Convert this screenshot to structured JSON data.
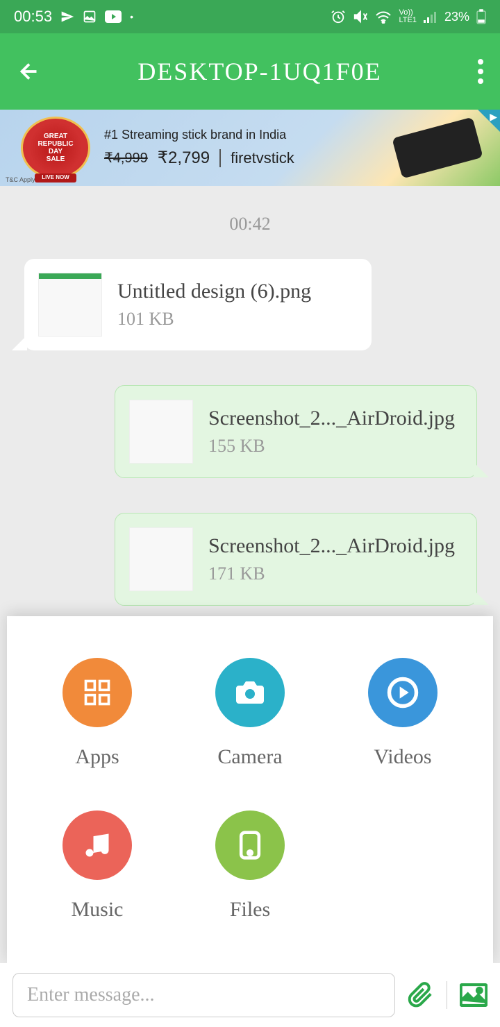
{
  "status": {
    "time": "00:53",
    "battery": "23%"
  },
  "header": {
    "title": "DESKTOP-1UQ1F0E"
  },
  "ad": {
    "headline": "#1 Streaming stick brand in India",
    "old_price": "₹4,999",
    "new_price": "₹2,799",
    "brand": "firetvstick",
    "badge_line1": "GREAT",
    "badge_line2": "REPUBLIC",
    "badge_line3": "DAY",
    "badge_line4": "SALE",
    "ribbon": "LIVE NOW",
    "tc": "T&C Apply"
  },
  "chat": {
    "timestamp": "00:42",
    "messages": [
      {
        "direction": "incoming",
        "filename": "Untitled design (6).png",
        "size": "101 KB"
      },
      {
        "direction": "outgoing",
        "filename": "Screenshot_2..._AirDroid.jpg",
        "size": "155 KB"
      },
      {
        "direction": "outgoing",
        "filename": "Screenshot_2..._AirDroid.jpg",
        "size": "171 KB"
      }
    ]
  },
  "attach": {
    "items": [
      {
        "label": "Apps"
      },
      {
        "label": "Camera"
      },
      {
        "label": "Videos"
      },
      {
        "label": "Music"
      },
      {
        "label": "Files"
      }
    ]
  },
  "input": {
    "placeholder": "Enter message..."
  }
}
